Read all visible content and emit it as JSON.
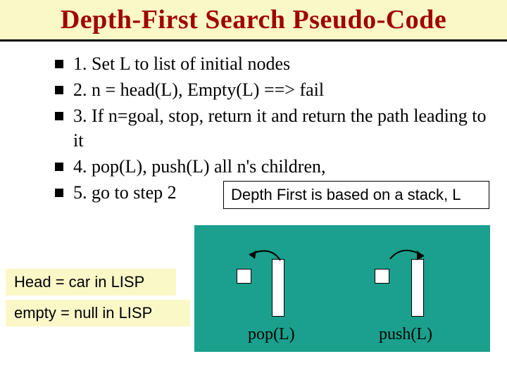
{
  "title": "Depth-First Search Pseudo-Code",
  "items": [
    "1. Set L to list of initial nodes",
    "2. n = head(L), Empty(L) ==> fail",
    "3. If n=goal, stop, return it and return the path leading to it",
    "4. pop(L), push(L) all n's children,",
    "5. go to step 2"
  ],
  "stackNote": "Depth First is based on a stack, L",
  "labels": {
    "head": "Head  = car in LISP",
    "empty": "empty  = null in LISP",
    "pop": "pop(L)",
    "push": "push(L)"
  }
}
